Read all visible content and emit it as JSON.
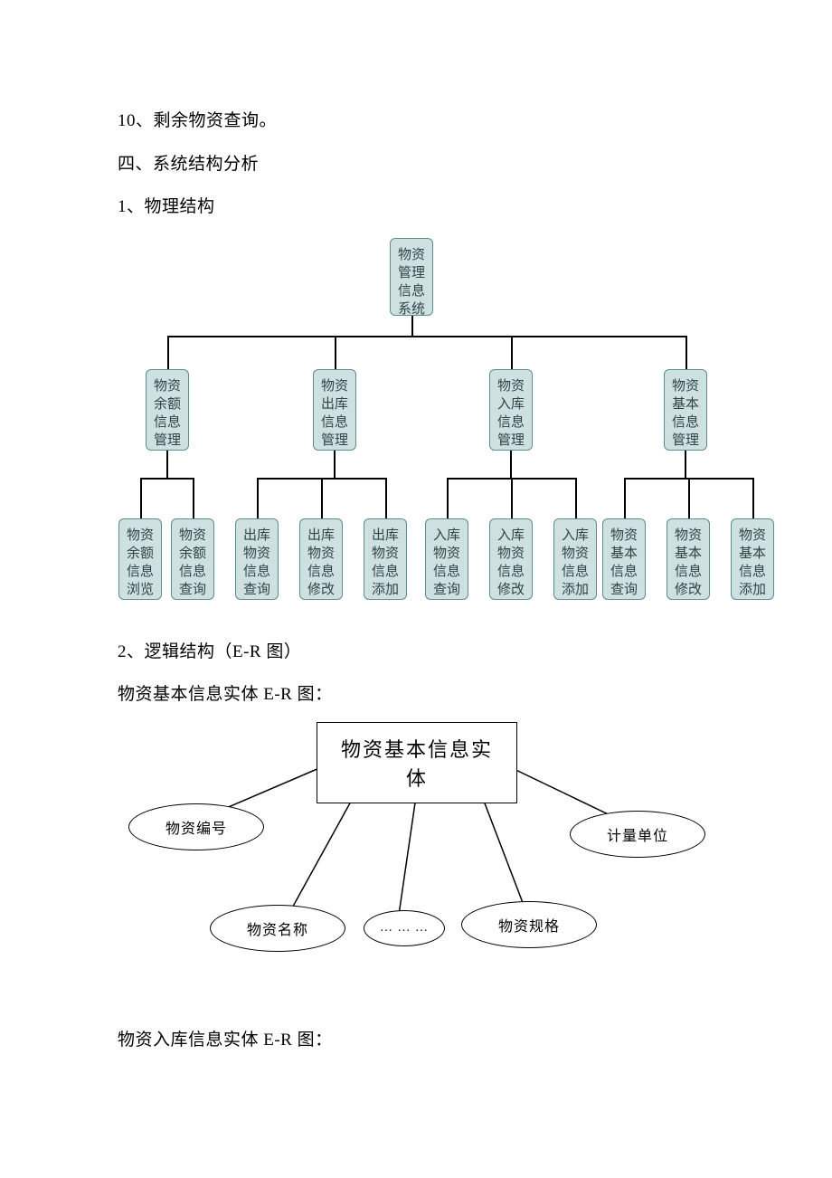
{
  "text": {
    "line10": "10、剩余物资查询。",
    "sec4": "四、系统结构分析",
    "sub1": "1、物理结构",
    "sub2": "2、逻辑结构（E-R 图）",
    "er1_title": "物资基本信息实体 E-R 图：",
    "er2_title": "物资入库信息实体 E-R 图："
  },
  "chart_data": {
    "type": "tree",
    "root": "物资管理信息系统",
    "children": [
      {
        "label": "物资余额信息管理",
        "children": [
          "物资余额信息浏览",
          "物资余额信息查询"
        ]
      },
      {
        "label": "物资出库信息管理",
        "children": [
          "出库物资信息查询",
          "出库物资信息修改",
          "出库物资信息添加"
        ]
      },
      {
        "label": "物资入库信息管理",
        "children": [
          "入库物资信息查询",
          "入库物资信息修改",
          "入库物资信息添加"
        ]
      },
      {
        "label": "物资基本信息管理",
        "children": [
          "物资基本信息查询",
          "物资基本信息修改",
          "物资基本信息添加"
        ]
      }
    ]
  },
  "er1": {
    "entity": "物资基本信息实体",
    "attributes": [
      "物资编号",
      "计量单位",
      "物资名称",
      "… … …",
      "物资规格"
    ]
  }
}
